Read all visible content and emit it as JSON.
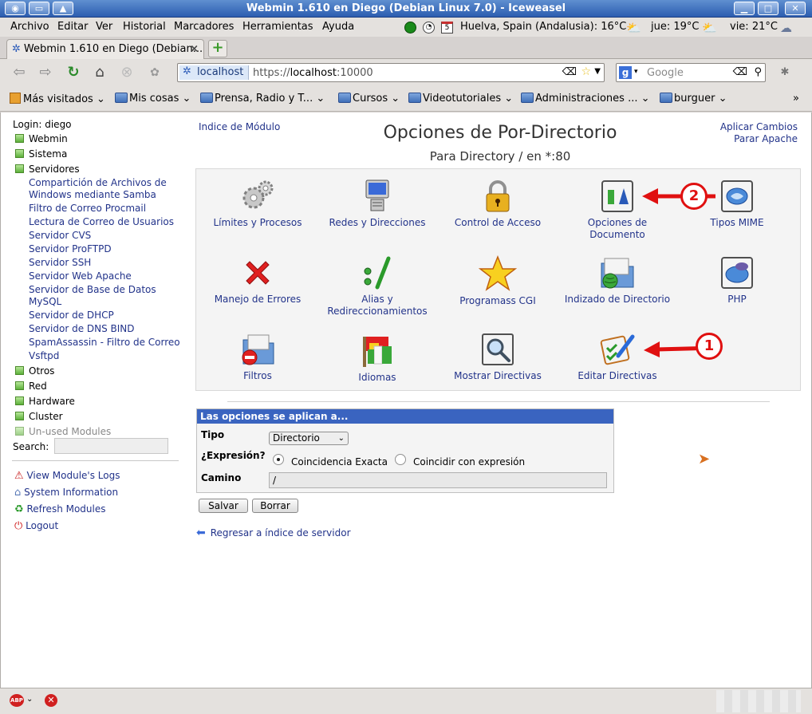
{
  "window": {
    "title": "Webmin 1.610 en Diego (Debian Linux 7.0) - Iceweasel"
  },
  "menubar": {
    "items": [
      "Archivo",
      "Editar",
      "Ver",
      "Historial",
      "Marcadores",
      "Herramientas",
      "Ayuda"
    ],
    "weather": {
      "location_now": "Huelva, Spain (Andalusia): 16°C",
      "day1": "jue: 19°C",
      "day2": "vie: 21°C"
    }
  },
  "tabs": [
    {
      "label": "Webmin 1.610 en Diego (Debian...",
      "close": "×"
    }
  ],
  "newtab_label": "+",
  "nav": {
    "site": "localhost",
    "url_scheme": "https://",
    "url_host": "localhost",
    "url_port": ":10000",
    "search_engine_letter": "g",
    "search_placeholder": "Google"
  },
  "bookmarks": [
    "Más visitados",
    "Mis cosas",
    "Prensa, Radio y T...",
    "Cursos",
    "Videotutoriales",
    "Administraciones ...",
    "burguer"
  ],
  "bookmarks_more": "»",
  "sidebar": {
    "login": "Login: diego",
    "categories_top": [
      "Webmin",
      "Sistema",
      "Servidores"
    ],
    "servers": [
      "Compartición de Archivos de",
      "Windows mediante Samba",
      "Filtro de Correo Procmail",
      "Lectura de Correo de Usuarios",
      "Servidor CVS",
      "Servidor ProFTPD",
      "Servidor SSH",
      "Servidor Web Apache",
      "Servidor de Base de Datos",
      "MySQL",
      "Servidor de DHCP",
      "Servidor de DNS BIND",
      "SpamAssassin - Filtro de Correo",
      "Vsftpd"
    ],
    "categories_bottom": [
      "Otros",
      "Red",
      "Hardware",
      "Cluster"
    ],
    "unused": "Un-used Modules",
    "search_label": "Search:",
    "links": [
      "View Module's Logs",
      "System Information",
      "Refresh Modules",
      "Logout"
    ]
  },
  "main": {
    "index_link": "Indice de Módulo",
    "title": "Opciones de Por-Directorio",
    "subtitle": "Para Directory / en *:80",
    "apply": "Aplicar Cambios",
    "stop": "Parar Apache",
    "icons": [
      [
        "Límites y Procesos"
      ],
      [
        "Redes y Direcciones"
      ],
      [
        "Control de Acceso"
      ],
      [
        "Opciones de",
        "Documento"
      ],
      [
        "Tipos MIME"
      ],
      [
        "Manejo de Errores"
      ],
      [
        "Alias y",
        "Redireccionamientos"
      ],
      [
        "Programass CGI"
      ],
      [
        "Indizado de Directorio"
      ],
      [
        "PHP"
      ],
      [
        "Filtros"
      ],
      [
        "Idiomas"
      ],
      [
        "Mostrar Directivas"
      ],
      [
        "Editar Directivas"
      ]
    ],
    "annotation_1": "1",
    "annotation_2": "2",
    "options": {
      "header": "Las opciones se aplican a...",
      "tipo_label": "Tipo",
      "tipo_value": "Directorio",
      "expr_label": "¿Expresión?",
      "radio_exact": "Coincidencia Exacta",
      "radio_regex": "Coincidir con expresión",
      "camino_label": "Camino",
      "camino_value": "/"
    },
    "save": "Salvar",
    "delete": "Borrar",
    "back": "Regresar a índice de servidor"
  }
}
